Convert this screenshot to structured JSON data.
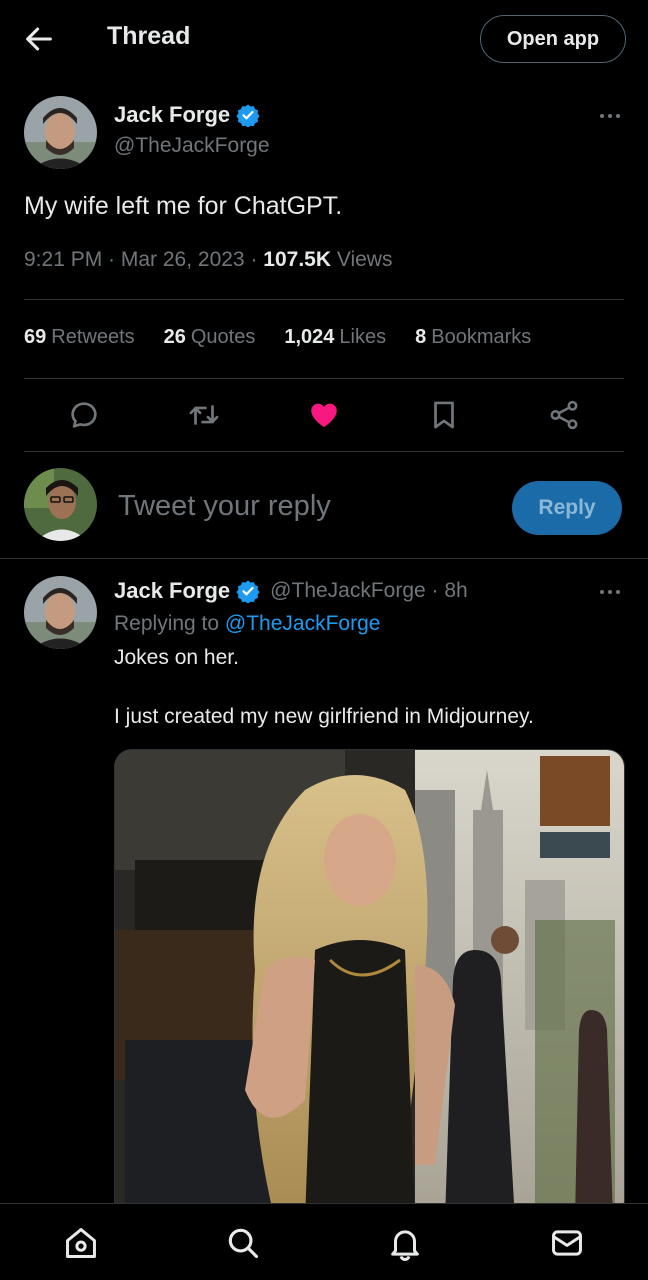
{
  "header": {
    "title": "Thread",
    "open_app_label": "Open app",
    "back_icon": "arrow-left-icon"
  },
  "main_tweet": {
    "name": "Jack Forge",
    "handle": "@TheJackForge",
    "verified": true,
    "text": "My wife left me for ChatGPT.",
    "time": "9:21 PM · Mar 26, 2023 · ",
    "views_count": "107.5K",
    "views_label": " Views",
    "stats": {
      "retweets_count": "69",
      "retweets_label": "Retweets",
      "quotes_count": "26",
      "quotes_label": "Quotes",
      "likes_count": "1,024",
      "likes_label": "Likes",
      "bookmarks_count": "8",
      "bookmarks_label": "Bookmarks"
    },
    "actions": [
      "reply-icon",
      "retweet-icon",
      "heart-filled-icon",
      "bookmark-icon",
      "share-icon"
    ],
    "liked": true
  },
  "reply_composer": {
    "placeholder": "Tweet your reply",
    "button_label": "Reply"
  },
  "reply_tweet": {
    "name": "Jack Forge",
    "handle": "@TheJackForge · 8h",
    "replying_prefix": "Replying to ",
    "replying_to": "@TheJackForge",
    "line1": "Jokes on her.",
    "line2": "I just created my new girlfriend in Midjourney."
  },
  "bottom_nav": [
    "home-icon",
    "search-icon",
    "notifications-icon",
    "messages-icon"
  ],
  "colors": {
    "accent": "#1d9bf0",
    "like": "#f91880",
    "muted": "#71767b",
    "text": "#e7e9ea",
    "background": "#000000"
  }
}
